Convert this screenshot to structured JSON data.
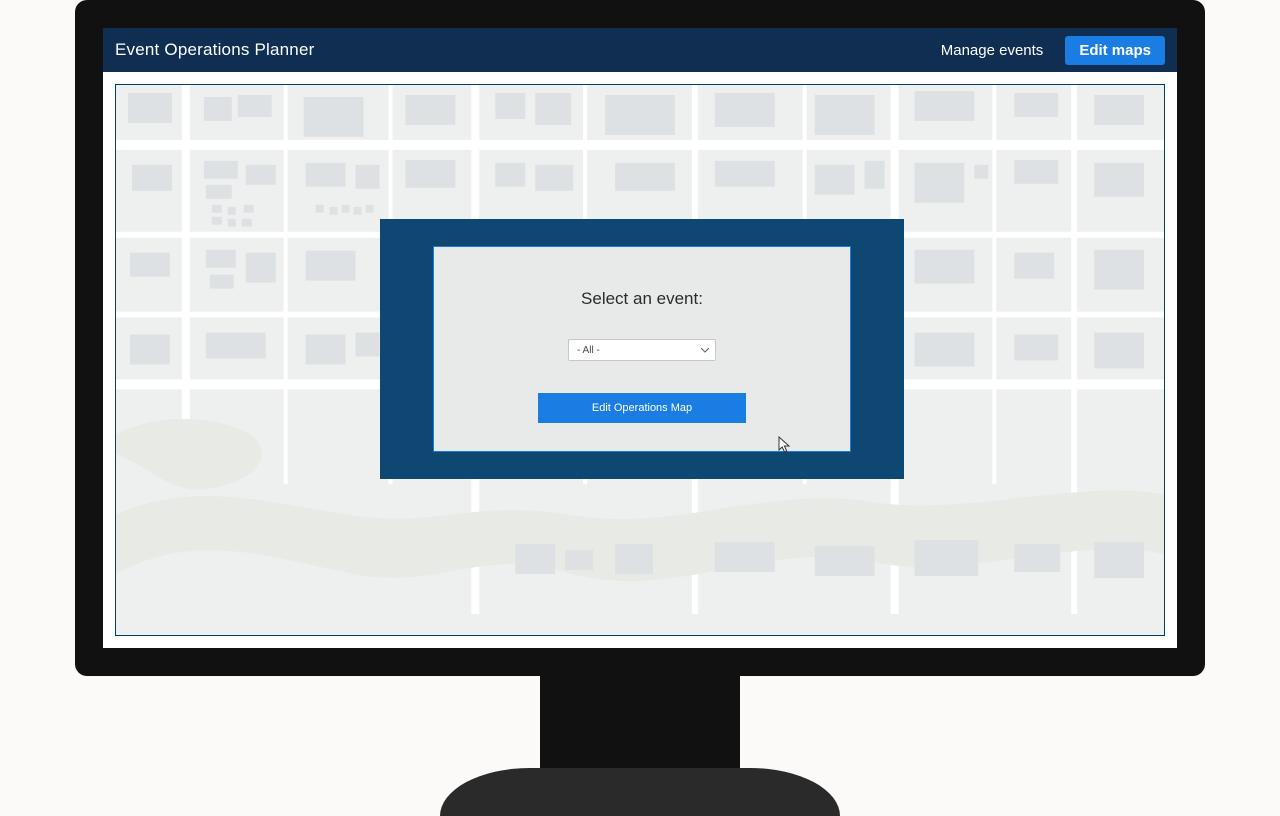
{
  "app": {
    "title": "Event Operations Planner"
  },
  "nav": {
    "manage_events_label": "Manage events",
    "edit_maps_label": "Edit maps"
  },
  "modal": {
    "title": "Select an event:",
    "event_select_value": "- All -",
    "edit_operations_map_label": "Edit Operations Map"
  },
  "colors": {
    "header_bg": "#0f2e52",
    "primary_blue": "#1a7de3",
    "modal_surround": "#0e4772",
    "modal_inner_bg": "#e8eaea"
  }
}
